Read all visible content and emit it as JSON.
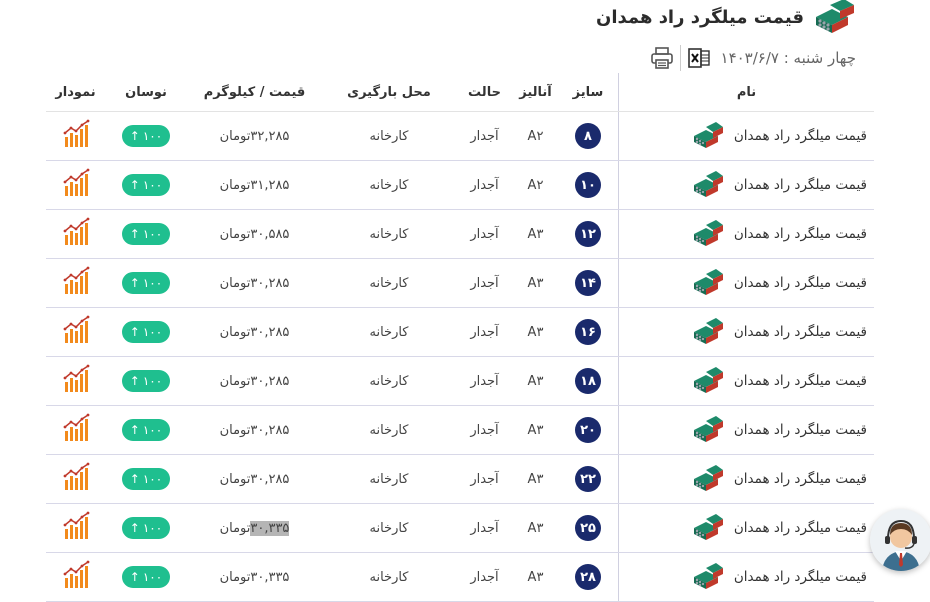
{
  "header": {
    "title": "قیمت میلگرد راد همدان",
    "date_label": "چهار شنبه : ۱۴۰۳/۶/۷"
  },
  "table": {
    "columns": {
      "name": "نام",
      "size": "سایز",
      "analysis": "آنالیز",
      "state": "حالت",
      "place": "محل بارگیری",
      "price": "قیمت / کیلوگرم",
      "change": "نوسان",
      "chart": "نمودار"
    },
    "rows": [
      {
        "name": "قیمت میلگرد راد همدان",
        "size": "۸",
        "analysis": "A۲",
        "state": "آجدار",
        "place": "کارخانه",
        "price": "۳۲,۲۸۵",
        "unit": "تومان",
        "change": "۱۰۰",
        "arrow": "↑"
      },
      {
        "name": "قیمت میلگرد راد همدان",
        "size": "۱۰",
        "analysis": "A۲",
        "state": "آجدار",
        "place": "کارخانه",
        "price": "۳۱,۲۸۵",
        "unit": "تومان",
        "change": "۱۰۰",
        "arrow": "↑"
      },
      {
        "name": "قیمت میلگرد راد همدان",
        "size": "۱۲",
        "analysis": "A۳",
        "state": "آجدار",
        "place": "کارخانه",
        "price": "۳۰,۵۸۵",
        "unit": "تومان",
        "change": "۱۰۰",
        "arrow": "↑"
      },
      {
        "name": "قیمت میلگرد راد همدان",
        "size": "۱۴",
        "analysis": "A۳",
        "state": "آجدار",
        "place": "کارخانه",
        "price": "۳۰,۲۸۵",
        "unit": "تومان",
        "change": "۱۰۰",
        "arrow": "↑"
      },
      {
        "name": "قیمت میلگرد راد همدان",
        "size": "۱۶",
        "analysis": "A۳",
        "state": "آجدار",
        "place": "کارخانه",
        "price": "۳۰,۲۸۵",
        "unit": "تومان",
        "change": "۱۰۰",
        "arrow": "↑"
      },
      {
        "name": "قیمت میلگرد راد همدان",
        "size": "۱۸",
        "analysis": "A۳",
        "state": "آجدار",
        "place": "کارخانه",
        "price": "۳۰,۲۸۵",
        "unit": "تومان",
        "change": "۱۰۰",
        "arrow": "↑"
      },
      {
        "name": "قیمت میلگرد راد همدان",
        "size": "۲۰",
        "analysis": "A۳",
        "state": "آجدار",
        "place": "کارخانه",
        "price": "۳۰,۲۸۵",
        "unit": "تومان",
        "change": "۱۰۰",
        "arrow": "↑"
      },
      {
        "name": "قیمت میلگرد راد همدان",
        "size": "۲۲",
        "analysis": "A۳",
        "state": "آجدار",
        "place": "کارخانه",
        "price": "۳۰,۲۸۵",
        "unit": "تومان",
        "change": "۱۰۰",
        "arrow": "↑"
      },
      {
        "name": "قیمت میلگرد راد همدان",
        "size": "۲۵",
        "analysis": "A۳",
        "state": "آجدار",
        "place": "کارخانه",
        "price": "۳۰,۳۳۵",
        "unit": "تومان",
        "change": "۱۰۰",
        "arrow": "↑"
      },
      {
        "name": "قیمت میلگرد راد همدان",
        "size": "۲۸",
        "analysis": "A۳",
        "state": "آجدار",
        "place": "کارخانه",
        "price": "۳۰,۳۳۵",
        "unit": "تومان",
        "change": "۱۰۰",
        "arrow": "↑"
      }
    ]
  },
  "icons": {
    "logo": "steel-bundle-logo-icon",
    "print": "printer-icon",
    "excel": "excel-icon",
    "chart": "bar-chart-icon",
    "support": "support-agent-icon"
  },
  "colors": {
    "size_badge": "#1a2a6c",
    "change_badge": "#1fbf8f",
    "chart_orange": "#f28a1c",
    "logo_green": "#1e8a6a",
    "logo_red": "#c0392b"
  }
}
